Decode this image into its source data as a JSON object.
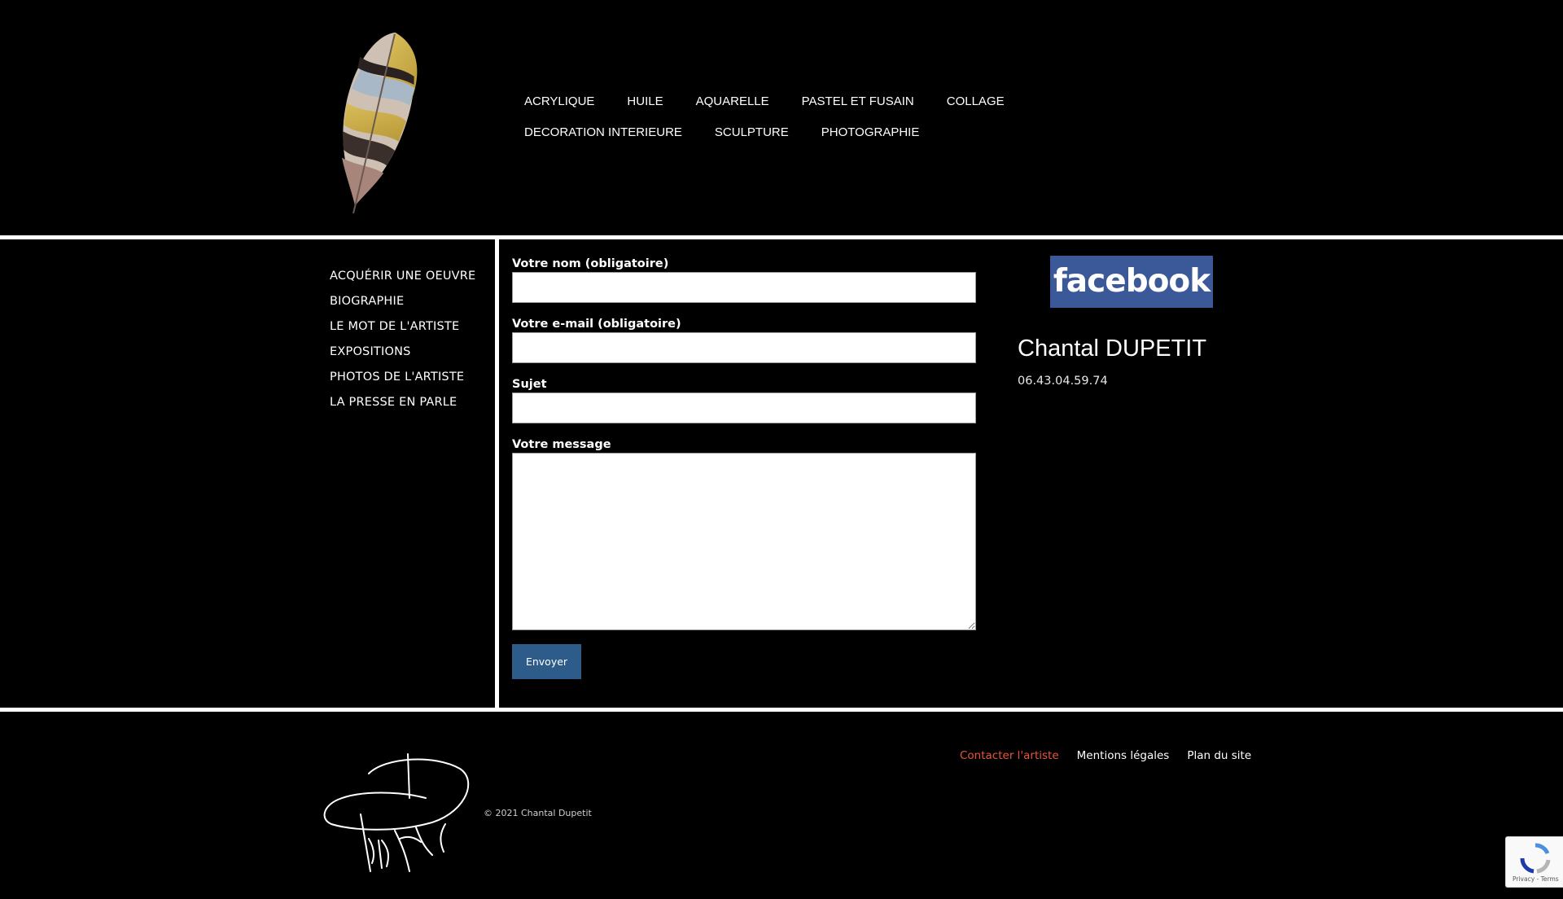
{
  "header": {
    "nav": [
      "ACRYLIQUE",
      "HUILE",
      "AQUARELLE",
      "PASTEL ET FUSAIN",
      "COLLAGE",
      "DECORATION INTERIEURE",
      "SCULPTURE",
      "PHOTOGRAPHIE"
    ]
  },
  "sidebar": {
    "items": [
      "ACQUÉRIR UNE OEUVRE",
      "BIOGRAPHIE",
      "LE MOT DE L'ARTISTE",
      "EXPOSITIONS",
      "PHOTOS DE L'ARTISTE",
      "LA PRESSE EN PARLE"
    ]
  },
  "form": {
    "name_label": "Votre nom (obligatoire)",
    "email_label": "Votre e-mail (obligatoire)",
    "subject_label": "Sujet",
    "message_label": "Votre message",
    "submit_label": "Envoyer"
  },
  "aside": {
    "facebook_label": "facebook",
    "artist_name": "Chantal DUPETIT",
    "phone": "06.43.04.59.74"
  },
  "footer": {
    "copyright": "© 2021 Chantal Dupetit",
    "links": [
      "Contacter l'artiste",
      "Mentions légales",
      "Plan du site"
    ],
    "recaptcha_terms": "Privacy - Terms"
  },
  "colors": {
    "background": "#000000",
    "separator": "#ffffff",
    "button": "#2e5c8a",
    "facebook": "#3b5998",
    "active_link": "#e8553f"
  }
}
